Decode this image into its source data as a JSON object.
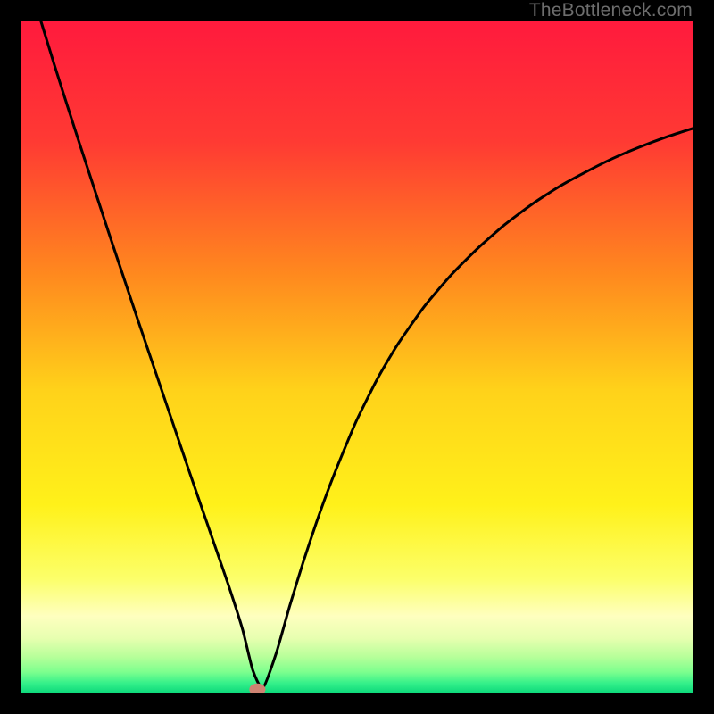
{
  "watermark": "TheBottleneck.com",
  "chart_data": {
    "type": "line",
    "title": "",
    "xlabel": "",
    "ylabel": "",
    "xlim": [
      0,
      100
    ],
    "ylim": [
      0,
      100
    ],
    "background_gradient": {
      "stops": [
        {
          "offset": 0.0,
          "color": "#ff1a3d"
        },
        {
          "offset": 0.18,
          "color": "#ff3a33"
        },
        {
          "offset": 0.38,
          "color": "#ff8a1e"
        },
        {
          "offset": 0.55,
          "color": "#ffd21a"
        },
        {
          "offset": 0.72,
          "color": "#fff11a"
        },
        {
          "offset": 0.83,
          "color": "#fcff6a"
        },
        {
          "offset": 0.885,
          "color": "#feffbf"
        },
        {
          "offset": 0.918,
          "color": "#e7ffb0"
        },
        {
          "offset": 0.945,
          "color": "#b8ff9a"
        },
        {
          "offset": 0.968,
          "color": "#7dff8e"
        },
        {
          "offset": 0.985,
          "color": "#34f08a"
        },
        {
          "offset": 1.0,
          "color": "#0bd77a"
        }
      ]
    },
    "series": [
      {
        "name": "bottleneck-curve",
        "color": "#000000",
        "x": [
          3,
          5,
          7,
          9,
          11,
          13,
          15,
          17,
          19,
          21,
          23,
          25,
          27,
          29,
          31,
          33,
          34.5,
          36,
          38,
          40,
          42,
          44,
          46,
          48,
          50,
          53,
          56,
          60,
          64,
          68,
          72,
          76,
          80,
          84,
          88,
          92,
          96,
          100
        ],
        "y": [
          100,
          93.5,
          87.2,
          81.0,
          74.9,
          68.8,
          62.8,
          56.8,
          50.9,
          45.0,
          39.1,
          33.2,
          27.4,
          21.6,
          15.8,
          9.5,
          3.5,
          0.8,
          6.0,
          13.0,
          19.5,
          25.5,
          31.0,
          36.0,
          40.7,
          46.7,
          51.8,
          57.5,
          62.2,
          66.2,
          69.7,
          72.7,
          75.3,
          77.5,
          79.5,
          81.2,
          82.7,
          84.0
        ]
      }
    ],
    "marker": {
      "name": "optimal-point",
      "x": 35.2,
      "y": 0.6,
      "rx": 1.2,
      "ry": 0.9,
      "color": "#cf8372"
    }
  }
}
